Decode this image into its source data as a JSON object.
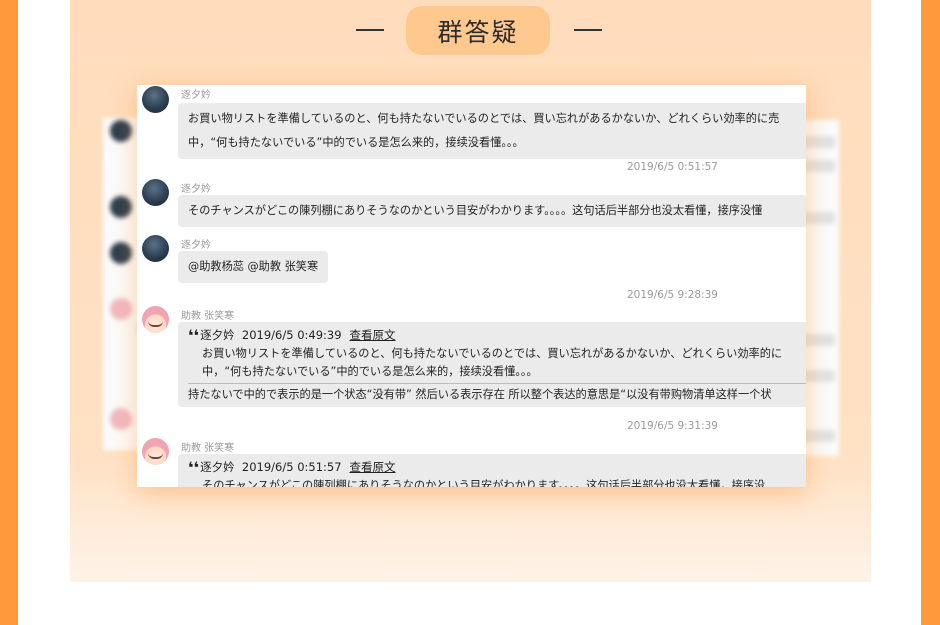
{
  "header": {
    "title": "群答疑"
  },
  "messages": [
    {
      "sender": "逐夕妗",
      "avatar_icon": "dark-photo-avatar",
      "lines": [
        "お買い物リストを準備しているのと、何も持たないでいるのとでは、買い忘れがあるかないか、どれくらい効率的に売",
        "中，“何も持たないでいる”中的でいる是怎么来的，接续没看懂。。。"
      ],
      "time": "2019/6/5 0:51:57"
    },
    {
      "sender": "逐夕妗",
      "avatar_icon": "dark-photo-avatar",
      "lines": [
        "そのチャンスがどこの陳列棚にありそうなのかという目安がわかります。。。。这句话后半部分也没太看懂，接序没懂"
      ]
    },
    {
      "sender": "逐夕妗",
      "avatar_icon": "dark-photo-avatar",
      "lines": [
        "@助教杨蕊 @助教 张笑寒"
      ],
      "time": "2019/6/5 9:28:39"
    },
    {
      "sender": "助教 张笑寒",
      "avatar_icon": "pink-cartoon-avatar",
      "quote": {
        "author": "逐夕妗",
        "time": "2019/6/5 0:49:39",
        "link": "查看原文",
        "lines": [
          "お買い物リストを準備しているのと、何も持たないでいるのとでは、買い忘れがあるかないか、どれくらい効率的に",
          "中，“何も持たないでいる”中的でいる是怎么来的，接续没看懂。。。"
        ]
      },
      "reply": "持たないで中的で表示的是一个状态“没有带” 然后いる表示存在 所以整个表达的意思是“以没有带购物清单这样一个状",
      "time": "2019/6/5 9:31:39"
    },
    {
      "sender": "助教 张笑寒",
      "avatar_icon": "pink-cartoon-avatar",
      "quote": {
        "author": "逐夕妗",
        "time": "2019/6/5 0:51:57",
        "link": "查看原文",
        "lines": [
          "そのチャンスがどこの陳列棚にありそうなのかという目安がわかります。。。。这句话后半部分也没太看懂，接序没"
        ]
      }
    }
  ],
  "colors": {
    "outer": "#ff9a3c",
    "panel": "#ffdcbc",
    "pill": "#ffc88f",
    "bubble": "#ebebeb"
  }
}
